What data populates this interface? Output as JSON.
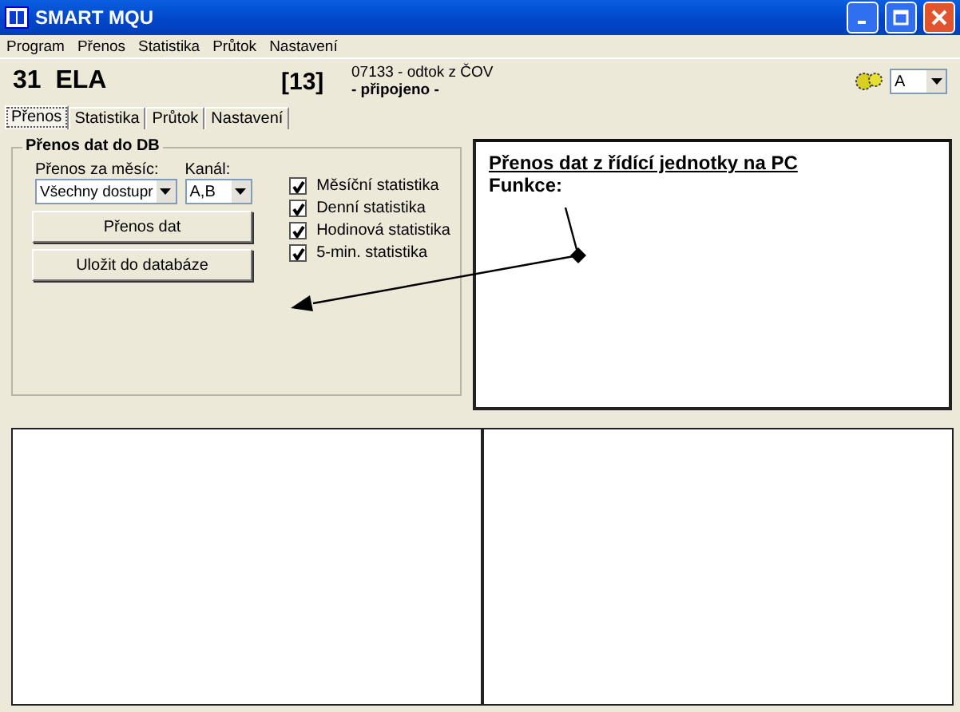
{
  "window": {
    "title": "SMART MQU"
  },
  "menu": [
    "Program",
    "Přenos",
    "Statistika",
    "Průtok",
    "Nastavení"
  ],
  "header": {
    "station": "31  ELA",
    "index": "[13]",
    "location": "07133 - odtok z ČOV",
    "status": "- připojeno -",
    "channel_select": "A"
  },
  "tabs": [
    {
      "label": "Přenos",
      "selected": true
    },
    {
      "label": "Statistika",
      "selected": false
    },
    {
      "label": "Průtok",
      "selected": false
    },
    {
      "label": "Nastavení",
      "selected": false
    }
  ],
  "group": {
    "title": "Přenos dat do DB",
    "month_label": "Přenos za měsíc:",
    "month_value": "Všechny dostupr",
    "channel_label": "Kanál:",
    "channel_value": "A,B",
    "buttons": [
      "Přenos dat",
      "Uložit do databáze"
    ],
    "checks": [
      {
        "label": "Měsíční statistika",
        "checked": true
      },
      {
        "label": "Denní statistika",
        "checked": true
      },
      {
        "label": "Hodinová statistika",
        "checked": true
      },
      {
        "label": "5-min. statistika",
        "checked": true
      }
    ]
  },
  "help": {
    "title": "Přenos dat z řídící jednotky na PC",
    "subtitle": "Funkce:"
  }
}
